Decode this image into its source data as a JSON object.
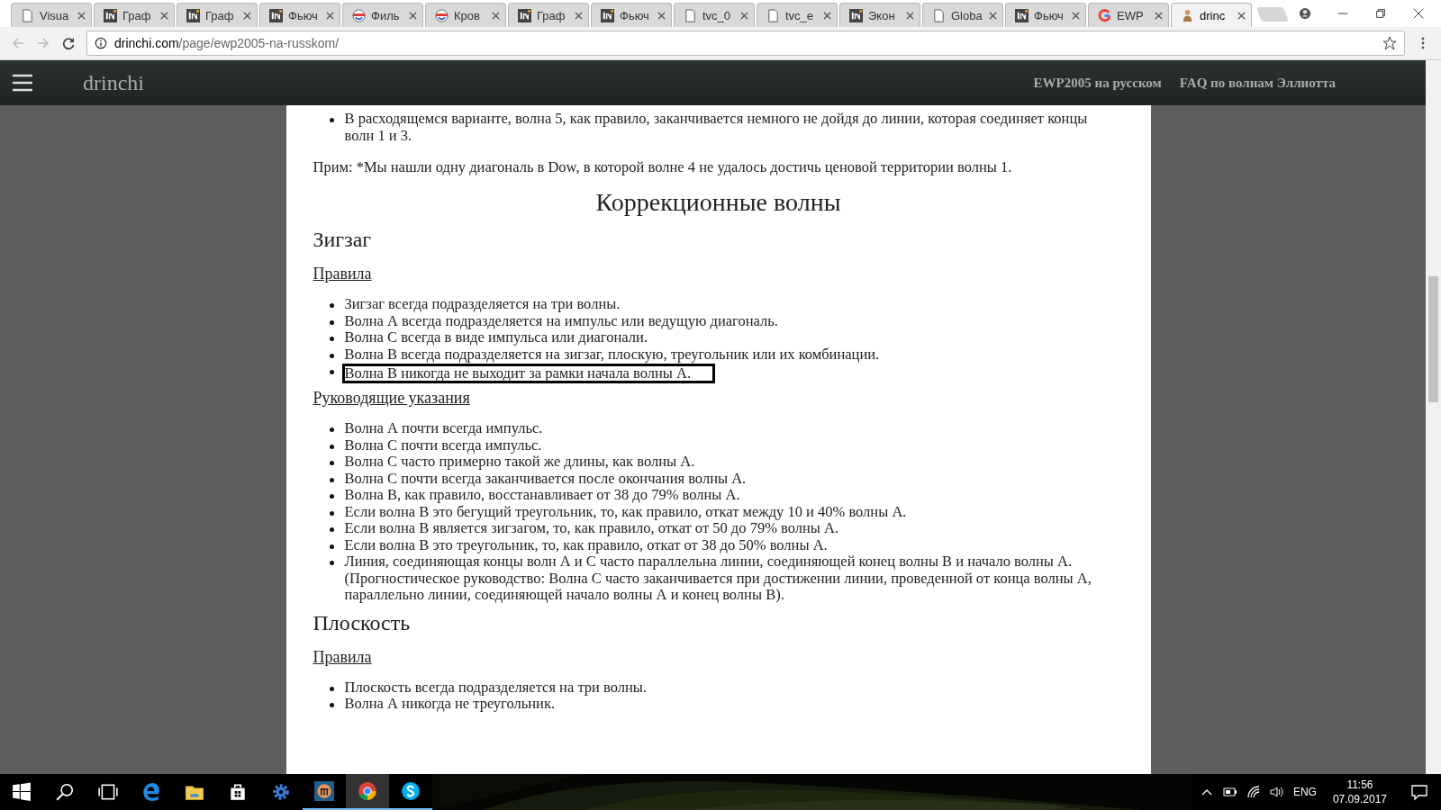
{
  "browser": {
    "tabs": [
      {
        "title": "Visua",
        "kind": "doc",
        "selected": false
      },
      {
        "title": "Граф",
        "kind": "inv",
        "selected": false
      },
      {
        "title": "Граф",
        "kind": "inv",
        "selected": false
      },
      {
        "title": "Фьюч",
        "kind": "inv",
        "selected": false
      },
      {
        "title": "Филь",
        "kind": "face",
        "selected": false
      },
      {
        "title": "Кров",
        "kind": "face",
        "selected": false
      },
      {
        "title": "Граф",
        "kind": "inv",
        "selected": false
      },
      {
        "title": "Фьюч",
        "kind": "inv",
        "selected": false
      },
      {
        "title": "tvc_0",
        "kind": "doc",
        "selected": false
      },
      {
        "title": "tvc_e",
        "kind": "doc",
        "selected": false
      },
      {
        "title": "Экон",
        "kind": "inv",
        "selected": false
      },
      {
        "title": "Globa",
        "kind": "doc",
        "selected": false
      },
      {
        "title": "Фьюч",
        "kind": "inv",
        "selected": false
      },
      {
        "title": "EWP",
        "kind": "google",
        "selected": false
      },
      {
        "title": "drinc",
        "kind": "figure",
        "selected": true
      }
    ],
    "address": {
      "domain": "drinchi.com",
      "path": "/page/ewp2005-na-russkom/"
    }
  },
  "site": {
    "logo": "drinchi",
    "nav": [
      "EWP2005 на русском",
      "FAQ по волнам Эллиотта"
    ]
  },
  "article": [
    {
      "kind": "bullets",
      "items": [
        {
          "text": "В расходящемся варианте, волна 5, как правило, заканчивается немного не дойдя до линии, которая соединяет концы волн 1 и 3.",
          "highlighted": false
        }
      ]
    },
    {
      "kind": "paragraph",
      "text": "Прим: *Мы нашли одну диагональ в Dow, в которой волне 4 не удалось достичь ценовой территории волны 1."
    },
    {
      "kind": "title",
      "text": "Коррекционные волны"
    },
    {
      "kind": "heading",
      "text": "Зигзаг"
    },
    {
      "kind": "subheading",
      "text": "Правила"
    },
    {
      "kind": "bullets",
      "items": [
        {
          "text": "Зигзаг всегда подразделяется на три волны.",
          "highlighted": false
        },
        {
          "text": "Волна А всегда подразделяется на импульс или ведущую диагональ.",
          "highlighted": false
        },
        {
          "text": "Волна С всегда в виде импульса или диагонали.",
          "highlighted": false
        },
        {
          "text": "Волна В всегда подразделяется на зигзаг, плоскую, треугольник или их комбинации.",
          "highlighted": false
        },
        {
          "text": "Волна В никогда не выходит за рамки начала волны А.",
          "highlighted": true
        }
      ]
    },
    {
      "kind": "subheading",
      "text": "Руководящие указания"
    },
    {
      "kind": "bullets",
      "items": [
        {
          "text": "Волна А почти всегда импульс.",
          "highlighted": false
        },
        {
          "text": "Волна С почти всегда импульс.",
          "highlighted": false
        },
        {
          "text": "Волна С часто примерно такой же длины, как волны А.",
          "highlighted": false
        },
        {
          "text": "Волна С почти всегда заканчивается после окончания волны А.",
          "highlighted": false
        },
        {
          "text": "Волна В, как правило, восстанавливает от 38 до 79% волны А.",
          "highlighted": false
        },
        {
          "text": "Если волна В это бегущий треугольник, то, как правило, откат между 10 и 40% волны А.",
          "highlighted": false
        },
        {
          "text": "Если волна В является зигзагом, то, как правило, откат от 50 до 79% волны А.",
          "highlighted": false
        },
        {
          "text": "Если волна В это треугольник, то, как правило, откат от 38 до 50% волны А.",
          "highlighted": false
        },
        {
          "text": "Линия, соединяющая концы волн А и С часто параллельна линии, соединяющей конец волны В и начало волны А. (Прогностическое руководство: Волна С часто заканчивается при достижении линии, проведенной от конца волны А, параллельно линии, соединяющей начало волны А и конец волны В).",
          "highlighted": false
        }
      ]
    },
    {
      "kind": "heading",
      "text": "Плоскость"
    },
    {
      "kind": "subheading",
      "text": "Правила"
    },
    {
      "kind": "bullets",
      "items": [
        {
          "text": "Плоскость всегда подразделяется на три волны.",
          "highlighted": false
        },
        {
          "text": "Волна А никогда не треугольник.",
          "highlighted": false
        }
      ]
    }
  ],
  "taskbar": {
    "apps": [
      {
        "kind": "start",
        "running": false,
        "active": false
      },
      {
        "kind": "search",
        "running": false,
        "active": false
      },
      {
        "kind": "taskview",
        "running": false,
        "active": false
      },
      {
        "kind": "edge",
        "running": false,
        "active": false
      },
      {
        "kind": "folder",
        "running": false,
        "active": false
      },
      {
        "kind": "store",
        "running": false,
        "active": false
      },
      {
        "kind": "gear",
        "running": false,
        "active": false
      },
      {
        "kind": "app",
        "running": true,
        "active": false
      },
      {
        "kind": "chrome",
        "running": true,
        "active": true
      },
      {
        "kind": "skype",
        "running": true,
        "active": false
      }
    ],
    "lang": "ENG",
    "time": "11:56",
    "date": "07.09.2017"
  }
}
